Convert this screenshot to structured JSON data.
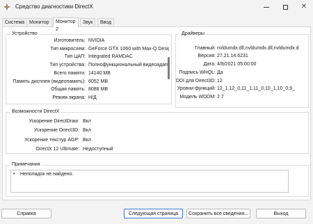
{
  "window": {
    "title": "Средство диагностики DirectX"
  },
  "tabs": [
    {
      "label": "Система"
    },
    {
      "label": "Монитор 1"
    },
    {
      "label": "Монитор 2"
    },
    {
      "label": "Звук"
    },
    {
      "label": "Ввод"
    }
  ],
  "device": {
    "title": "Устройство",
    "rows": [
      {
        "label": "Изготовитель:",
        "value": "NVIDIA"
      },
      {
        "label": "Тип микросхем:",
        "value": "GeForce GTX 1060 with Max-Q Design"
      },
      {
        "label": "Тип ЦАП:",
        "value": "Integrated RAMDAC"
      },
      {
        "label": "Тип устройства:",
        "value": "Полнофункциональный видеоадаптер"
      },
      {
        "label": "Всего памяти:",
        "value": "14140 MB"
      },
      {
        "label": "Память дисплея (видеопамять):",
        "value": "6052 MB"
      },
      {
        "label": "Общая память:",
        "value": "8088 MB"
      },
      {
        "label": "Режим экрана:",
        "value": "Н/Д"
      }
    ]
  },
  "drivers": {
    "title": "Драйверы",
    "rows": [
      {
        "label": "Главный:",
        "value": "nvldumdx.dll,nvldumdx.dll,nvldumdx.d"
      },
      {
        "label": "Версия:",
        "value": "27.21.14.6231"
      },
      {
        "label": "Дата:",
        "value": "4/8/2021 05:00:00"
      },
      {
        "label": "Подпись WHQL:",
        "value": "Да"
      },
      {
        "label": "DDI для Direct3D:",
        "value": "12"
      },
      {
        "label": "Уровни функций:",
        "value": "12_1,12_0,11_1,11_0,10_1,10_0,9_"
      },
      {
        "label": "Модель WDDM:",
        "value": "2.7"
      }
    ]
  },
  "directx": {
    "title": "Возможности DirectX",
    "rows": [
      {
        "label": "Ускорение DirectDraw:",
        "value": "Вкл"
      },
      {
        "label": "Ускорение Direct3D:",
        "value": "Вкл"
      },
      {
        "label": "Ускорение текстур AGP:",
        "value": "Вкл"
      },
      {
        "label": "DirectX 12 Ultimate:",
        "value": "Недоступный"
      }
    ]
  },
  "notes": {
    "title": "Примечания",
    "items": [
      "Неполадок не найдено."
    ]
  },
  "buttons": {
    "help": "Справка",
    "next": "Следующая страница",
    "save": "Сохранить все сведения...",
    "exit": "Выход"
  }
}
